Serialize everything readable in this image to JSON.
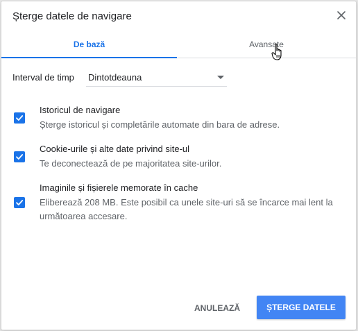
{
  "dialog": {
    "title": "Șterge datele de navigare",
    "close_icon": "close-icon"
  },
  "tabs": [
    {
      "label": "De bază",
      "active": true
    },
    {
      "label": "Avansate",
      "active": false
    }
  ],
  "time_range": {
    "label": "Interval de timp",
    "value": "Dintotdeauna"
  },
  "options": [
    {
      "title": "Istoricul de navigare",
      "description": "Șterge istoricul și completările automate din bara de adrese.",
      "checked": true
    },
    {
      "title": "Cookie-urile și alte date privind site-ul",
      "description": "Te deconectează de pe majoritatea site-urilor.",
      "checked": true
    },
    {
      "title": "Imaginile și fișierele memorate în cache",
      "description": "Eliberează 208 MB. Este posibil ca unele site-uri să se încarce mai lent la următoarea accesare.",
      "checked": true
    }
  ],
  "buttons": {
    "cancel": "ANULEAZĂ",
    "clear": "ȘTERGE DATELE"
  },
  "colors": {
    "accent": "#1a73e8",
    "primary_button": "#4285f4"
  }
}
